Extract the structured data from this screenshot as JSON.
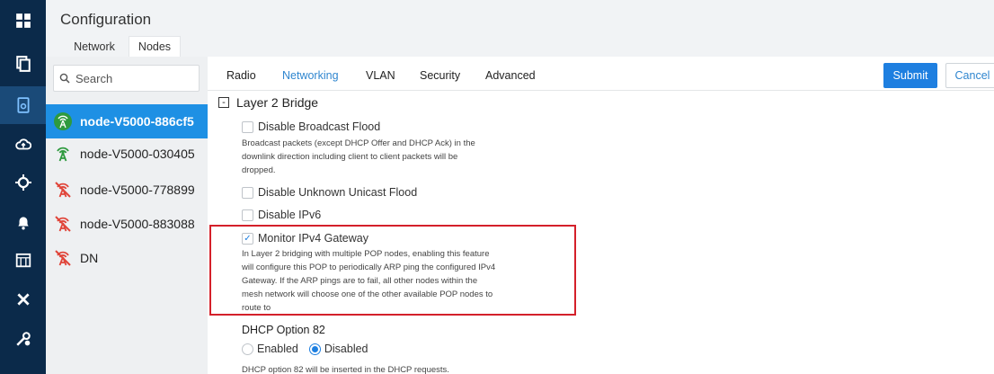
{
  "header": {
    "title": "Configuration",
    "tabs": [
      "Network",
      "Nodes"
    ]
  },
  "rail": {
    "icons": [
      "dashboard-icon",
      "copy-icon",
      "config-icon",
      "cloud-upload-icon",
      "target-icon",
      "bell-icon",
      "calendar-icon",
      "tools-icon",
      "settings-icon"
    ],
    "active_index": 2
  },
  "search": {
    "placeholder": "Search"
  },
  "nodes": [
    {
      "name": "node-V5000-886cf5",
      "status": "online",
      "selected": true
    },
    {
      "name": "node-V5000-030405",
      "status": "online",
      "selected": false
    },
    {
      "name": "node-V5000-778899",
      "status": "offline",
      "selected": false
    },
    {
      "name": "node-V5000-883088",
      "status": "offline",
      "selected": false
    },
    {
      "name": "DN",
      "status": "offline",
      "selected": false
    }
  ],
  "config_tabs": [
    "Radio",
    "Networking",
    "VLAN",
    "Security",
    "Advanced"
  ],
  "active_config_tab": "Networking",
  "actions": {
    "submit": "Submit",
    "cancel": "Cancel"
  },
  "layer2": {
    "title": "Layer 2 Bridge",
    "toggle": "-",
    "disable_broadcast_flood": {
      "label": "Disable Broadcast Flood",
      "checked": false,
      "desc": [
        "Broadcast packets (except DHCP Offer and DHCP Ack) in the",
        "downlink direction including client to client packets will be",
        "dropped."
      ]
    },
    "disable_unknown_unicast_flood": {
      "label": "Disable Unknown Unicast Flood",
      "checked": false
    },
    "disable_ipv6": {
      "label": "Disable IPv6",
      "checked": false
    },
    "monitor_ipv4_gateway": {
      "label": "Monitor IPv4 Gateway",
      "checked": true,
      "check_glyph": "✓",
      "desc": [
        "In Layer 2 bridging with multiple POP nodes, enabling this feature",
        "will configure this POP to periodically ARP ping the configured IPv4",
        "Gateway. If the ARP pings are to fail, all other nodes within the",
        "mesh network will choose one of the other available POP nodes to",
        "route to"
      ]
    }
  },
  "dhcp82": {
    "title": "DHCP Option 82",
    "options": [
      "Enabled",
      "Disabled"
    ],
    "selected": "Disabled",
    "desc": "DHCP option 82 will be inserted in the DHCP requests."
  },
  "colors": {
    "rail_bg": "#0b2a4a",
    "selected_node_bg": "#1e90e4",
    "online_icon": "#2e9a3e",
    "offline_icon": "#e0453a",
    "accent": "#1e7fe0",
    "highlight_border": "#d4202a"
  }
}
